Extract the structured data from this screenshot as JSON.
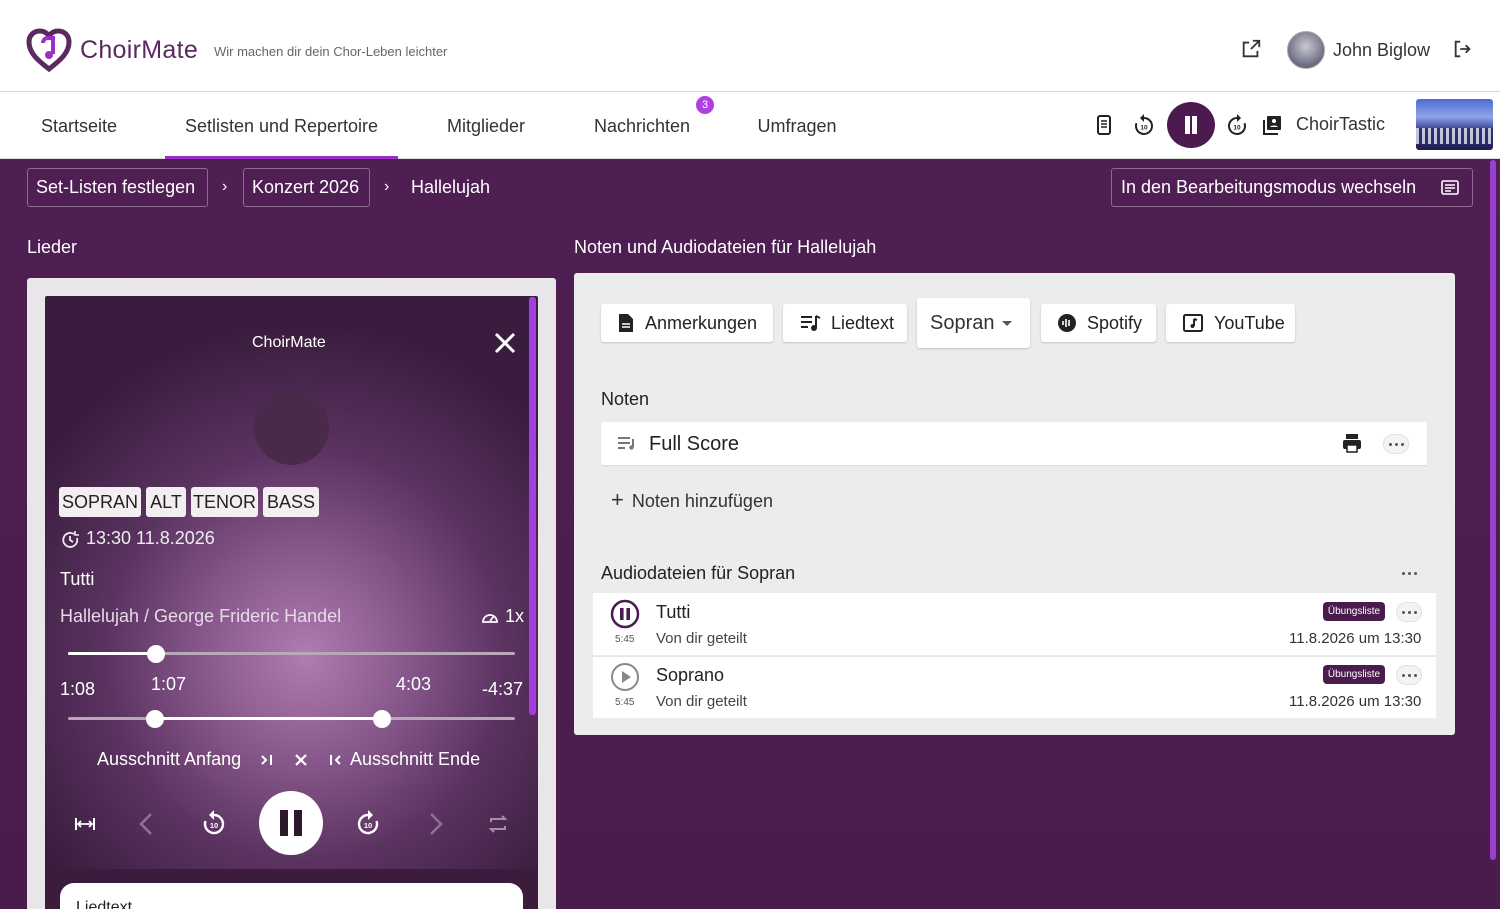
{
  "header": {
    "brand": "ChoirMate",
    "tagline": "Wir machen dir dein Chor-Leben leichter",
    "user_name": "John Biglow"
  },
  "nav": {
    "tabs": [
      "Startseite",
      "Setlisten und Repertoire",
      "Mitglieder",
      "Nachrichten",
      "Umfragen"
    ],
    "active_tab": "Setlisten und Repertoire",
    "messages_badge": "3",
    "choir_name": "ChoirTastic"
  },
  "breadcrumb": {
    "items": [
      "Set-Listen festlegen",
      "Konzert 2026"
    ],
    "current": "Hallelujah",
    "edit_mode_label": "In den Bearbeitungsmodus wechseln"
  },
  "left": {
    "section_title": "Lieder",
    "player": {
      "title": "ChoirMate",
      "voices": [
        "SOPRAN",
        "ALT",
        "TENOR",
        "BASS"
      ],
      "date": "13:30 11.8.2026",
      "track": "Tutti",
      "song": "Hallelujah / George Frideric Handel",
      "speed": "1x",
      "elapsed": "1:08",
      "remaining": "-4:37",
      "progress_fraction": 0.196,
      "segment_start": "1:07",
      "segment_end": "4:03",
      "segment_start_fraction": 0.194,
      "segment_end_fraction": 0.702,
      "segment_start_label": "Ausschnitt Anfang",
      "segment_end_label": "Ausschnitt Ende"
    },
    "lyrics_card_label": "Liedtext"
  },
  "right": {
    "section_title": "Noten und Audiodateien für Hallelujah",
    "buttons": {
      "notes": "Anmerkungen",
      "lyrics": "Liedtext",
      "voice_select": "Sopran",
      "spotify": "Spotify",
      "youtube": "YouTube"
    },
    "scores_title": "Noten",
    "scores": [
      {
        "name": "Full Score"
      }
    ],
    "add_notes_label": "Noten hinzufügen",
    "audio_title": "Audiodateien für Sopran",
    "audio": [
      {
        "title": "Tutti",
        "shared": "Von dir geteilt",
        "duration": "5:45",
        "badge": "Übungsliste",
        "date": "11.8.2026 um 13:30",
        "state": "playing"
      },
      {
        "title": "Soprano",
        "shared": "Von dir geteilt",
        "duration": "5:45",
        "badge": "Übungsliste",
        "date": "11.8.2026 um 13:30",
        "state": "paused"
      }
    ]
  },
  "colors": {
    "brand_purple": "#4f1f53",
    "accent": "#9b2fc9"
  }
}
